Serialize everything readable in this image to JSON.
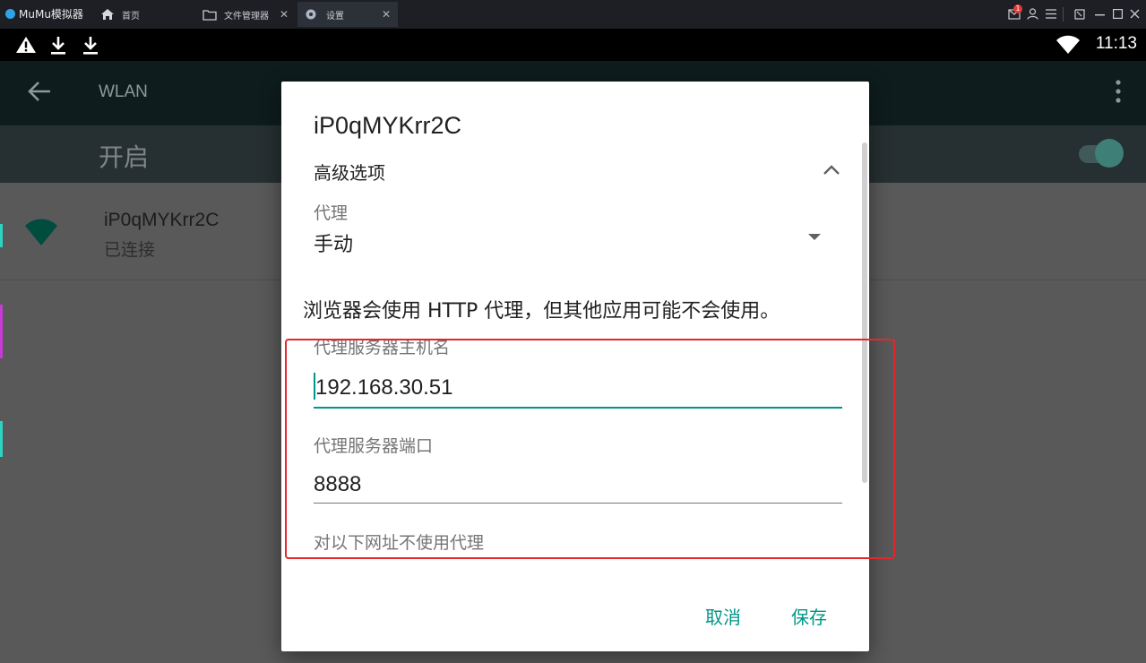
{
  "titlebar": {
    "brand": "MuMu模拟器",
    "tabs": [
      {
        "label": "首页",
        "icon": "home-icon"
      },
      {
        "label": "文件管理器",
        "icon": "folder-icon"
      },
      {
        "label": "设置",
        "icon": "settings-icon"
      }
    ],
    "mail_badge": "1"
  },
  "statusbar": {
    "time": "11:13"
  },
  "appbar": {
    "title": "WLAN"
  },
  "switchbar": {
    "label": "开启"
  },
  "network": {
    "ssid": "iP0qMYKrr2C",
    "status": "已连接"
  },
  "dialog": {
    "title": "iP0qMYKrr2C",
    "advanced_label": "高级选项",
    "proxy_label": "代理",
    "proxy_value": "手动",
    "message": "浏览器会使用 HTTP 代理，但其他应用可能不会使用。",
    "host_label": "代理服务器主机名",
    "host_value": "192.168.30.51",
    "port_label": "代理服务器端口",
    "port_value": "8888",
    "bypass_label": "对以下网址不使用代理",
    "cancel": "取消",
    "save": "保存"
  },
  "colors": {
    "accent": "#009688",
    "highlight": "#e5262a"
  }
}
